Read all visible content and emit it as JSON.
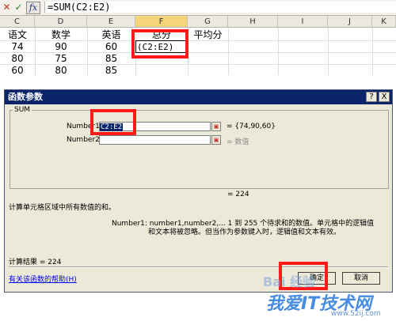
{
  "formula_bar": {
    "cancel_glyph": "✕",
    "enter_glyph": "✓",
    "fx_label": "fx",
    "formula": "=SUM(C2:E2)"
  },
  "sheet": {
    "columns": [
      "C",
      "D",
      "E",
      "F",
      "G",
      "H",
      "I",
      "J",
      "K"
    ],
    "selected_column": "F",
    "headers": [
      "语文",
      "数学",
      "英语",
      "总分",
      "平均分"
    ],
    "rows": [
      [
        "74",
        "90",
        "60"
      ],
      [
        "80",
        "75",
        "85"
      ],
      [
        "60",
        "80",
        "85"
      ]
    ],
    "edit_cell_text": "(C2:E2)"
  },
  "dialog": {
    "title": "函数参数",
    "help_button": "?",
    "close_button": "X",
    "function_name": "SUM",
    "args": [
      {
        "label": "Number1",
        "value": "C2:E2",
        "result": "= {74,90,60}"
      },
      {
        "label": "Number2",
        "value": "",
        "result": "= 数值"
      }
    ],
    "total_result": "= 224",
    "description": "计算单元格区域中所有数值的和。",
    "param_help_line1": "Number1:  number1,number2,...  1 到 255 个待求和的数值。单元格中的逻辑值",
    "param_help_line2": "和文本将被忽略。但当作为参数键入时，逻辑值和文本有效。",
    "calc_result": "计算结果 = 224",
    "help_link": "有关该函数的帮助(H)",
    "ok_button": "确定",
    "cancel_button": "取消"
  },
  "watermark": {
    "line1": "Bai 经验",
    "line2": "我爱IT技术网",
    "line3": "www.52ij.com"
  },
  "colors": {
    "highlight_red": "#ff1a1a",
    "title_bar": "#0a246a",
    "dialog_bg": "#ece9d8"
  }
}
